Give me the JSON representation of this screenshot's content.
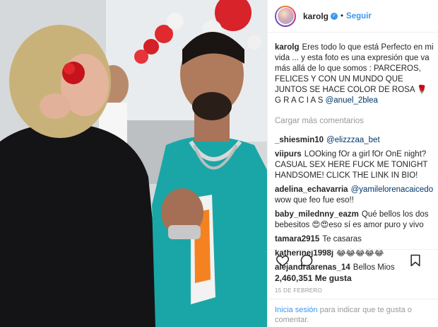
{
  "post": {
    "username": "karolg",
    "follow_label": "Seguir",
    "separator": "•",
    "caption": {
      "username": "karolg",
      "text": "Eres todo lo que está Perfecto en mi vida ... y esta foto es una expresión que va más allá de lo que somos : PARCEROS, FELICES Y CON UN MUNDO QUE JUNTOS SE HACE COLOR DE ROSA 🌹 G R A C I A S",
      "mention": "@anuel_2blea"
    },
    "load_more": "Cargar más comentarios",
    "comments": [
      {
        "user": "_shiesmin10",
        "text": "",
        "mention": "@elizzzaa_bet"
      },
      {
        "user": "viipurs",
        "text": "LOOking fOr a girl fOr OnE night? CASUAL SEX HERE FUCK ME TONIGHT HANDSOME! CLICK THE LINK IN BIO!",
        "mention": ""
      },
      {
        "user": "adelina_echavarria",
        "text": "wow que feo fue eso!!",
        "mention": "@yamilelorenacaicedo"
      },
      {
        "user": "baby_milednny_eazm",
        "text": "Qué bellos los dos bebesitos 😍😍eso sí es amor puro y vivo",
        "mention": ""
      },
      {
        "user": "tamara2915",
        "text": "Te casaras",
        "mention": ""
      },
      {
        "user": "katherinej1998j",
        "text": "😂😂😂😂😂",
        "mention": ""
      },
      {
        "user": "alejandraarenas_14",
        "text": "Bellos Mios",
        "mention": ""
      }
    ],
    "likes": "2,460,351 Me gusta",
    "date": "15 DE FEBRERO",
    "login_link": "Inicia sesión",
    "login_text": "para indicar que te gusta o comentar."
  },
  "icons": {
    "like": "heart-icon",
    "comment": "comment-icon",
    "save": "bookmark-icon",
    "verified": "verified-badge-icon"
  },
  "colors": {
    "link": "#3897f0",
    "mention": "#003569",
    "muted": "#999999",
    "text": "#262626"
  }
}
